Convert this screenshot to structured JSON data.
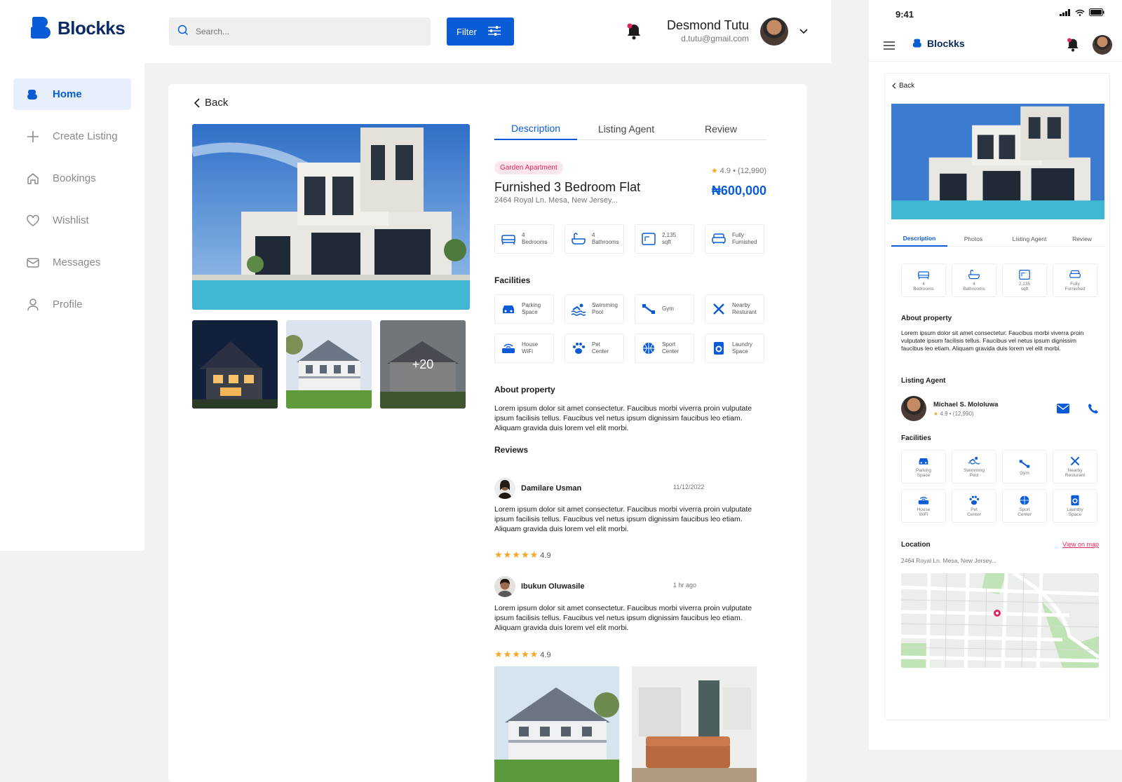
{
  "app": {
    "name": "Blockks"
  },
  "sidebar": {
    "items": [
      {
        "label": "Home",
        "icon": "logo-icon"
      },
      {
        "label": "Create Listing",
        "icon": "plus-icon"
      },
      {
        "label": "Bookings",
        "icon": "home-icon"
      },
      {
        "label": "Wishlist",
        "icon": "heart-icon"
      },
      {
        "label": "Messages",
        "icon": "mail-icon"
      },
      {
        "label": "Profile",
        "icon": "user-icon"
      }
    ]
  },
  "topbar": {
    "search_placeholder": "Search...",
    "filter_label": "Filter",
    "user_name": "Desmond Tutu",
    "user_email": "d.tutu@gmail.com"
  },
  "listing": {
    "back_label": "Back",
    "tabs": [
      "Description",
      "Listing Agent",
      "Review"
    ],
    "tag": "Garden Apartment",
    "rating": "4.9",
    "rating_count": "(12,990)",
    "title": "Furnished 3 Bedroom Flat",
    "price": "₦600,000",
    "address": "2464 Royal Ln. Mesa, New Jersey...",
    "thumb_more": "+20",
    "specs": [
      {
        "line1": "4",
        "line2": "Bedrooms",
        "icon": "bed-icon"
      },
      {
        "line1": "4",
        "line2": "Bathrooms",
        "icon": "bath-icon"
      },
      {
        "line1": "2,135",
        "line2": "sqft",
        "icon": "area-icon"
      },
      {
        "line1": "Fully",
        "line2": "Furnished",
        "icon": "sofa-icon"
      }
    ],
    "facilities_title": "Facilities",
    "facilities": [
      {
        "line1": "Parking",
        "line2": "Space",
        "icon": "car-icon"
      },
      {
        "line1": "Swimming",
        "line2": "Pool",
        "icon": "swim-icon"
      },
      {
        "line1": "Gym",
        "line2": "",
        "icon": "dumbbell-icon"
      },
      {
        "line1": "Nearby",
        "line2": "Resturant",
        "icon": "cutlery-icon"
      },
      {
        "line1": "House",
        "line2": "WiFi",
        "icon": "wifi-icon"
      },
      {
        "line1": "Pet",
        "line2": "Center",
        "icon": "paw-icon"
      },
      {
        "line1": "Sport",
        "line2": "Center",
        "icon": "ball-icon"
      },
      {
        "line1": "Laundry",
        "line2": "Space",
        "icon": "washer-icon"
      }
    ],
    "about_title": "About property",
    "about_text": "Lorem ipsum dolor sit amet consectetur. Faucibus morbi viverra proin vulputate ipsum facilisis tellus. Faucibus vel netus ipsum dignissim faucibus leo etiam. Aliquam gravida duis lorem vel elit morbi.",
    "reviews_title": "Reviews",
    "reviews": [
      {
        "name": "Damilare Usman",
        "date": "11/12/2022",
        "text": "Lorem ipsum dolor sit amet consectetur. Faucibus morbi viverra proin vulputate ipsum facilisis tellus. Faucibus vel netus ipsum dignissim faucibus leo etiam. Aliquam gravida duis lorem vel elit morbi.",
        "rating": "4.9"
      },
      {
        "name": "Ibukun Oluwasile",
        "date": "1 hr ago",
        "text": "Lorem ipsum dolor sit amet consectetur. Faucibus morbi viverra proin vulputate ipsum facilisis tellus. Faucibus vel netus ipsum dignissim faucibus leo etiam. Aliquam gravida duis lorem vel elit morbi.",
        "rating": "4.9"
      }
    ]
  },
  "mobile": {
    "time": "9:41",
    "back_label": "Back",
    "tabs": [
      "Description",
      "Photos",
      "Listing Agent",
      "Review"
    ],
    "about_title": "About property",
    "about_text": "Lorem ipsum dolor sit amet consectetur. Faucibus morbi viverra proin vulputate ipsum facilisis tellus. Faucibus vel netus ipsum dignissim faucibus leo etiam. Aliquam gravida duis lorem vel elit morbi.",
    "agent_title": "Listing Agent",
    "agent_name": "Michael S. Mololuwa",
    "agent_rating": "4.9",
    "agent_rating_count": "(12,990)",
    "facilities_title": "Facilities",
    "location_title": "Location",
    "view_map_label": "View on map",
    "location_address": "2464 Royal Ln. Mesa, New Jersey..."
  },
  "colors": {
    "accent": "#0a5cd6",
    "tag_text": "#e0245e",
    "tag_bg": "#fde7ec",
    "star": "#f5a623"
  }
}
